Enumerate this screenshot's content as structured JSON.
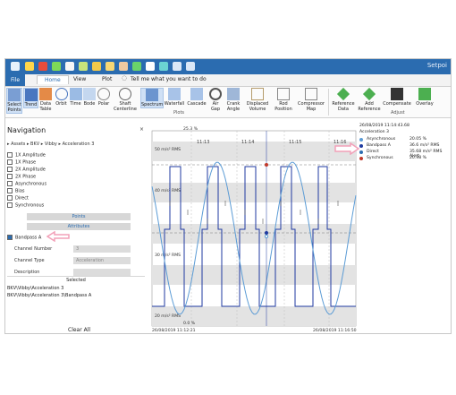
{
  "window": {
    "title": "Setpoi",
    "search_placeholder": "Tell me what you want to do"
  },
  "tabs": [
    {
      "label": "File"
    },
    {
      "label": "Home"
    },
    {
      "label": "View"
    },
    {
      "label": "Plot"
    }
  ],
  "ribbon": {
    "buttons": [
      {
        "label": "Select\nPoints"
      },
      {
        "label": "Trend"
      },
      {
        "label": "Data\nTable"
      },
      {
        "label": "Orbit"
      },
      {
        "label": "Time"
      },
      {
        "label": "Bode"
      },
      {
        "label": "Polar"
      },
      {
        "label": "Shaft\nCenterline"
      },
      {
        "label": "Spectrum"
      },
      {
        "label": "Waterfall"
      },
      {
        "label": "Cascade"
      },
      {
        "label": "Air\nGap"
      },
      {
        "label": "Crank\nAngle"
      },
      {
        "label": "Displaced\nVolume"
      },
      {
        "label": "Rod\nPosition"
      },
      {
        "label": "Compressor\nMap"
      },
      {
        "label": "Reference\nData"
      },
      {
        "label": "Add\nReference"
      },
      {
        "label": "Compensate"
      },
      {
        "label": "Overlay"
      }
    ],
    "groups": {
      "plots": "Plots",
      "adjust": "Adjust"
    }
  },
  "navigation": {
    "title": "Navigation",
    "close": "×",
    "breadcrumb": "▸ Assets ▸ BKV ▸ Vibby ▸ Acceleration 3",
    "options": [
      "1X Amplitude",
      "1X Phase",
      "2X Amplitude",
      "2X Phase",
      "Asynchronous",
      "Bias",
      "Direct",
      "Synchronous"
    ],
    "points_label": "Points",
    "attributes_label": "Attributes",
    "checked_item": "Bandpass A",
    "fields": [
      {
        "label": "Channel Number",
        "value": "3"
      },
      {
        "label": "Channel Type",
        "value": "Acceleration"
      },
      {
        "label": "Description",
        "value": ""
      }
    ],
    "selected_header": "Selected",
    "selected_paths": [
      "BKV\\Vibby\\Acceleration 3",
      "BKV\\Vibby\\Acceleration 3\\Bandpass A"
    ],
    "clear_all": "Clear All"
  },
  "chart_data": {
    "type": "line",
    "x_ticks_top": [
      "11:13",
      "11:14",
      "11:15",
      "11:16"
    ],
    "y_labels": [
      "50 m/s² RMS",
      "40 m/s² RMS",
      "30 m/s² RMS",
      "20 m/s² RMS"
    ],
    "top_value": "25.3 %",
    "bottom_value": "0.0 %",
    "start_time": "26/08/2019 11:12:21",
    "end_time": "26/08/2019 11:16:50",
    "grid": true,
    "series": [
      {
        "name": "Bandpass A",
        "color": "#1f3aa0"
      },
      {
        "name": "Direct",
        "color": "#5b9bd5"
      }
    ]
  },
  "legend": {
    "timestamp": "26/08/2019 11:14:43.68",
    "sub": "Acceleration 3",
    "rows": [
      {
        "name": "Asynchronous",
        "value": "20.05 %",
        "color": "#5b9bd5"
      },
      {
        "name": "Bandpass A",
        "value": "36.6 m/s² RMS",
        "color": "#1f3aa0"
      },
      {
        "name": "Direct",
        "value": "35.68 m/s² RMS Alert",
        "color": "#2b6cb0"
      },
      {
        "name": "Synchronous",
        "value": "20.98 %",
        "color": "#c0392b"
      }
    ]
  },
  "colors": {
    "accent": "#2b6cb0",
    "highlight_arrow": "#f2a0b8"
  }
}
